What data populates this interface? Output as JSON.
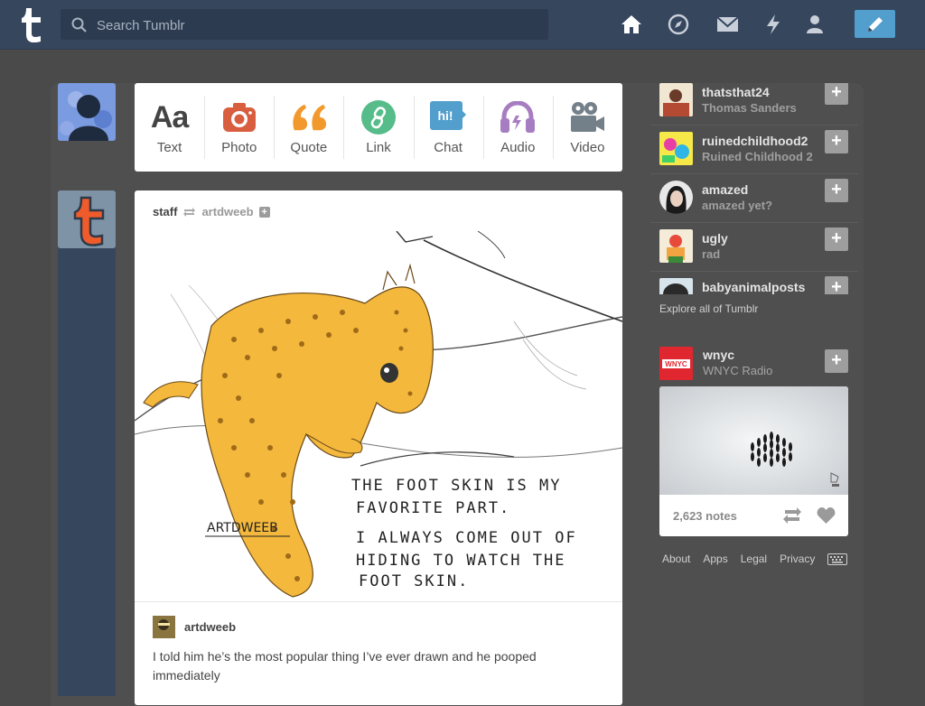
{
  "header": {
    "search_placeholder": "Search Tumblr",
    "nav": [
      "home-icon",
      "compass-icon",
      "mail-icon",
      "lightning-icon",
      "account-icon"
    ],
    "compose_icon": "pencil-icon"
  },
  "post_bar": [
    {
      "label": "Text",
      "icon": "text-icon",
      "color": "#444444"
    },
    {
      "label": "Photo",
      "icon": "camera-icon",
      "color": "#d95e40"
    },
    {
      "label": "Quote",
      "icon": "quote-icon",
      "color": "#f2992e"
    },
    {
      "label": "Link",
      "icon": "link-icon",
      "color": "#56bc8a"
    },
    {
      "label": "Chat",
      "icon": "chat-icon",
      "color": "#529ecc"
    },
    {
      "label": "Audio",
      "icon": "headphones-icon",
      "color": "#a77dc2"
    },
    {
      "label": "Video",
      "icon": "video-camera-icon",
      "color": "#748089"
    }
  ],
  "post": {
    "author": "staff",
    "source": "artdweeb",
    "follow_symbol": "+",
    "reply_user": "artdweeb",
    "reply_text": "I told him he’s the most popular thing I’ve ever drawn and he pooped immediately",
    "image_caption_lines": [
      "THE FOOT SKIN IS MY",
      "FAVORITE PART.",
      "I ALWAYS COME OUT OF",
      "HIDING TO WATCH THE",
      "FOOT SKIN."
    ],
    "signature": "ARTDWEEB"
  },
  "recommended": [
    {
      "name": "thatsthat24",
      "sub": "Thomas Sanders",
      "follow": "+"
    },
    {
      "name": "ruinedchildhood2",
      "sub": "Ruined Childhood 2",
      "follow": "+"
    },
    {
      "name": "amazed",
      "sub": "amazed yet?",
      "follow": "+"
    },
    {
      "name": "ugly",
      "sub": "rad",
      "follow": "+"
    },
    {
      "name": "babyanimalposts",
      "sub": "",
      "follow": "+"
    }
  ],
  "explore": "Explore all of Tumblr",
  "radar": {
    "name": "wnyc",
    "sub": "WNYC Radio",
    "follow": "+",
    "logo_text": "WNYC",
    "notes": "2,623 notes"
  },
  "footer": [
    "About",
    "Apps",
    "Legal",
    "Privacy"
  ],
  "colors": {
    "header": "#36465d",
    "dashboard": "#4f4f4f",
    "compose": "#529ecc"
  }
}
